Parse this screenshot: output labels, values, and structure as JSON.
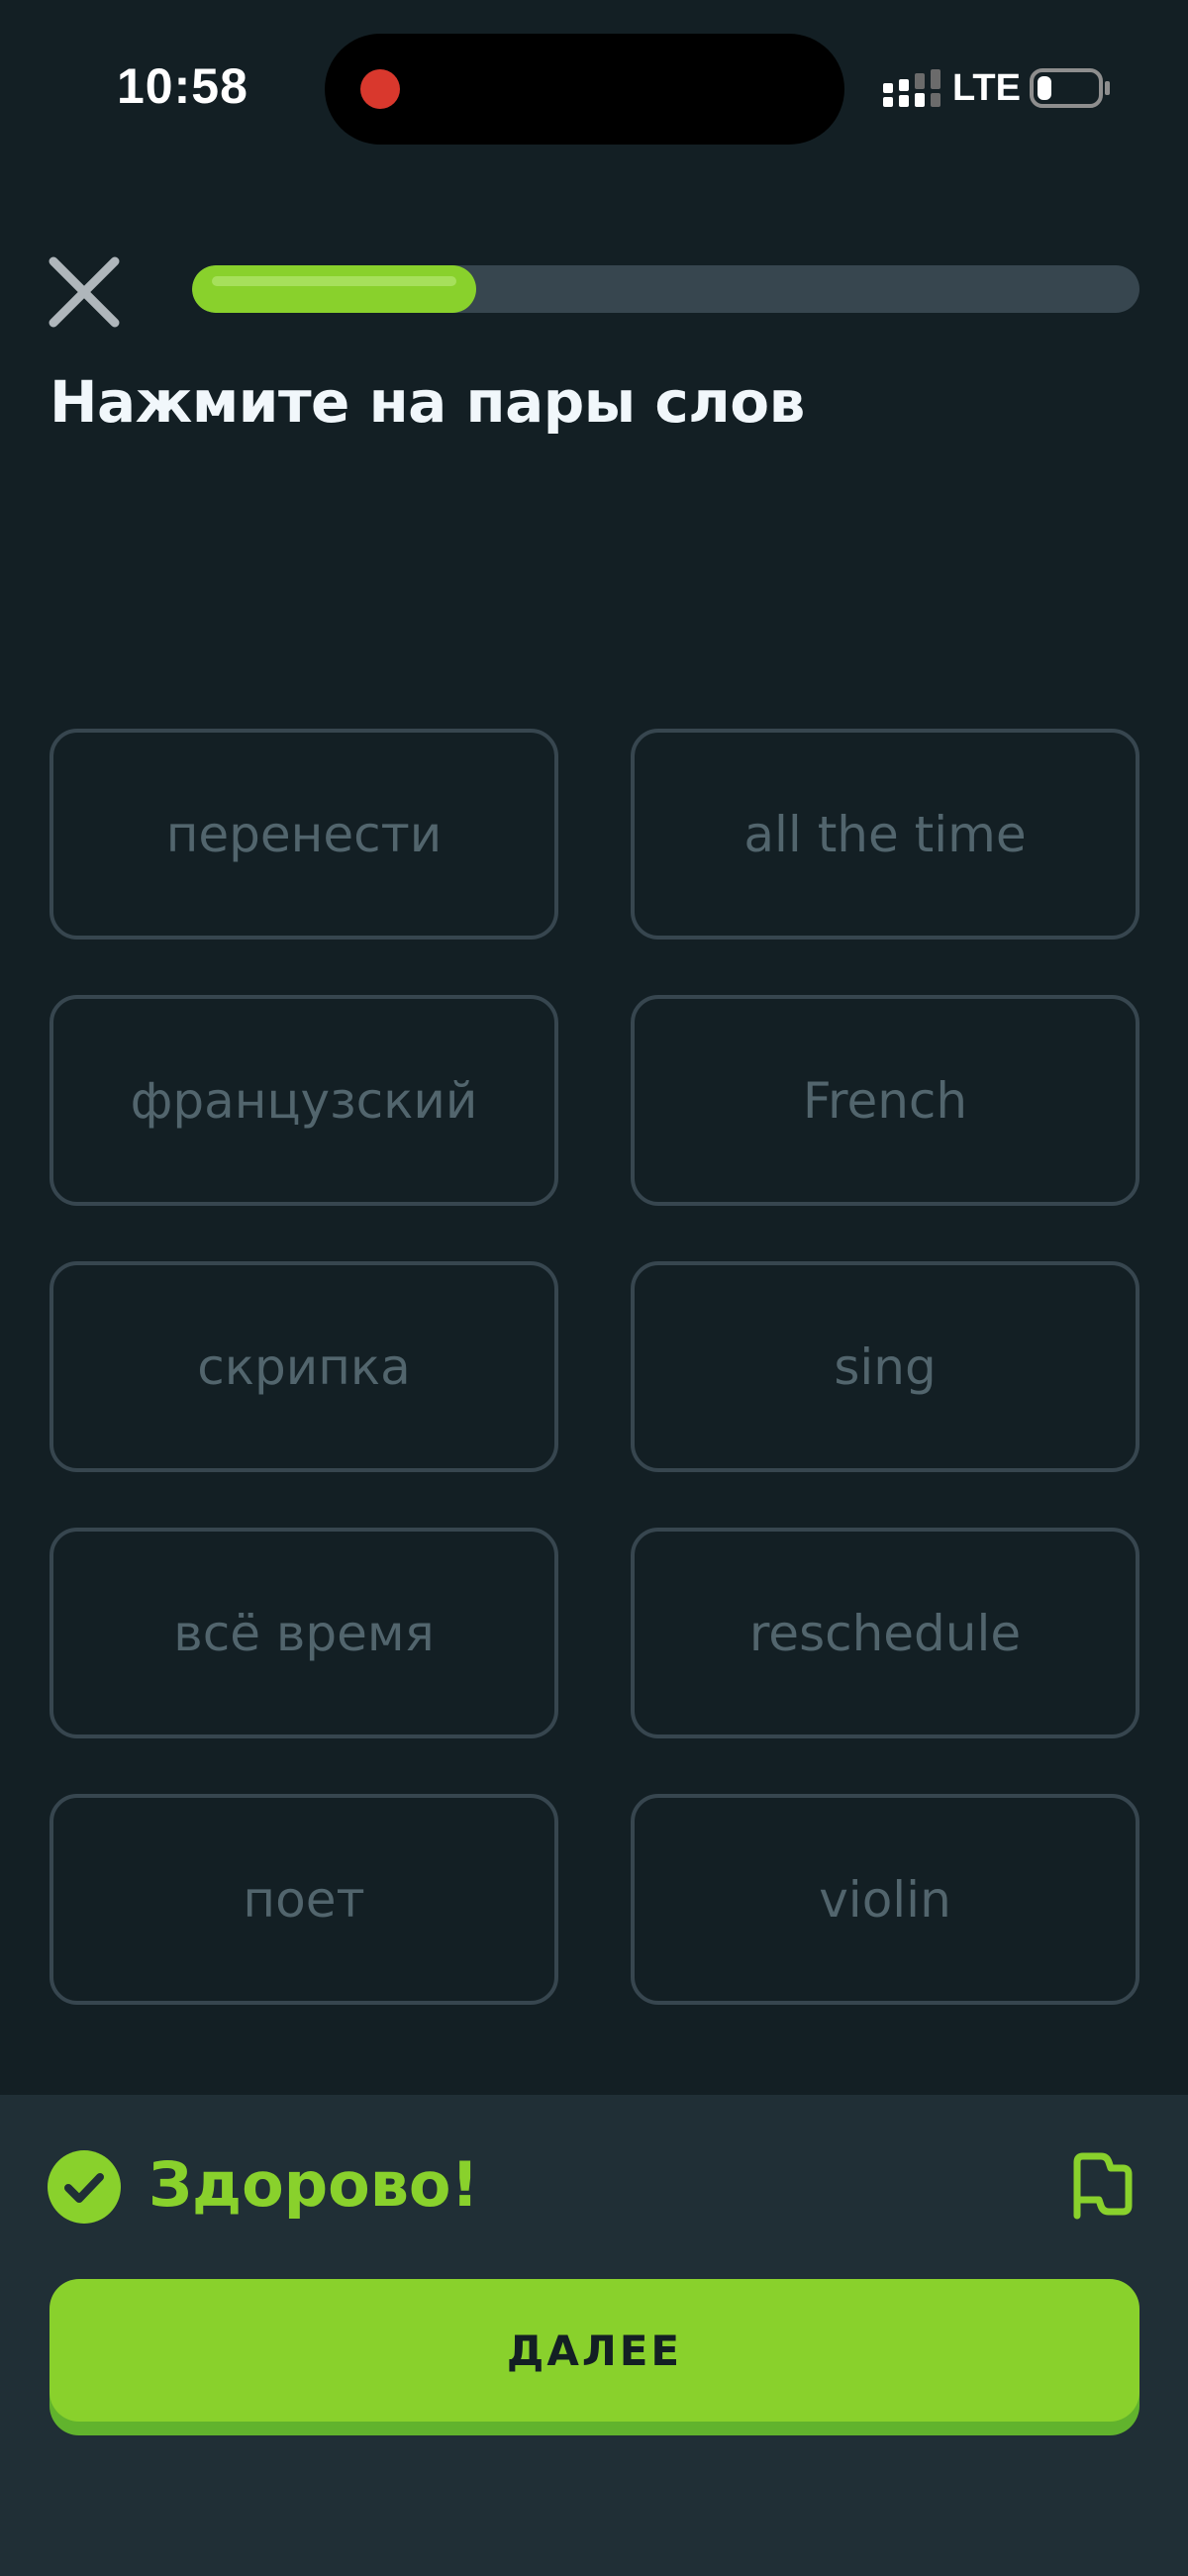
{
  "status_bar": {
    "time": "10:58",
    "network": "LTE",
    "recording_indicator_color": "#d9382d"
  },
  "header": {
    "close_icon": "close-x-icon",
    "progress_fraction": 0.3,
    "title": "Нажмите на пары слов"
  },
  "words": [
    {
      "text": "перенести",
      "state": "matched"
    },
    {
      "text": "all the time",
      "state": "matched"
    },
    {
      "text": "французский",
      "state": "matched"
    },
    {
      "text": "French",
      "state": "matched"
    },
    {
      "text": "скрипка",
      "state": "matched"
    },
    {
      "text": "sing",
      "state": "matched"
    },
    {
      "text": "всё время",
      "state": "matched"
    },
    {
      "text": "reschedule",
      "state": "matched"
    },
    {
      "text": "поет",
      "state": "matched"
    },
    {
      "text": "violin",
      "state": "matched"
    }
  ],
  "feedback": {
    "icon": "check-circle-icon",
    "message": "Здорово!",
    "report_icon": "flag-icon"
  },
  "continue_button": {
    "label": "ДАЛЕЕ"
  },
  "colors": {
    "background": "#131f24",
    "accent_green": "#89d12c",
    "accent_green_shadow": "#61b32d",
    "tile_border": "#37464f",
    "tile_text_disabled": "#52656d",
    "footer_background": "#202f36"
  }
}
